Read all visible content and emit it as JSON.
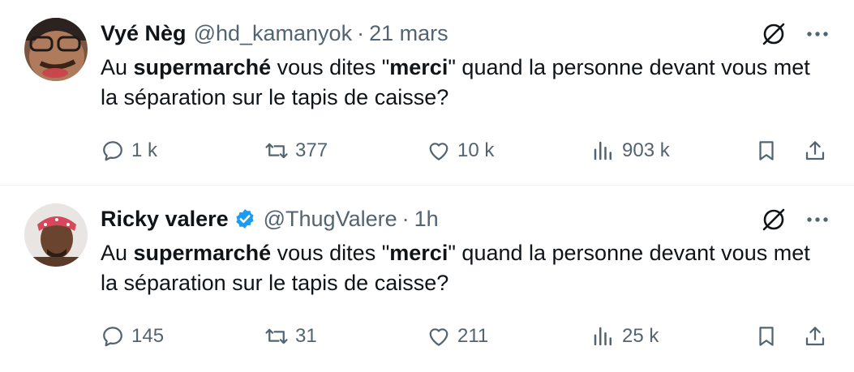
{
  "tweets": [
    {
      "display_name": "Vyé Nèg",
      "verified": false,
      "handle": "@hd_kamanyok",
      "separator": "·",
      "time": "21 mars",
      "text_parts": [
        "Au ",
        "supermarché",
        " vous dites \"",
        "merci",
        "\" quand la personne devant vous met la séparation sur le tapis de caisse?"
      ],
      "replies": "1 k",
      "retweets": "377",
      "likes": "10 k",
      "views": "903 k"
    },
    {
      "display_name": "Ricky valere",
      "verified": true,
      "handle": "@ThugValere",
      "separator": "·",
      "time": "1h",
      "text_parts": [
        "Au ",
        "supermarché",
        " vous dites \"",
        "merci",
        "\" quand la personne devant vous met la séparation sur le tapis de caisse?"
      ],
      "replies": "145",
      "retweets": "31",
      "likes": "211",
      "views": "25 k"
    }
  ],
  "icons": {
    "reply": "reply-icon",
    "retweet": "retweet-icon",
    "like": "like-icon",
    "views": "views-icon",
    "bookmark": "bookmark-icon",
    "share": "share-icon",
    "grok": "grok-icon",
    "more": "more-icon",
    "verified": "verified-badge-icon"
  },
  "colors": {
    "text_primary": "#0f1419",
    "text_secondary": "#536471",
    "verified_blue": "#1d9bf0",
    "separator": "#eff3f4"
  }
}
